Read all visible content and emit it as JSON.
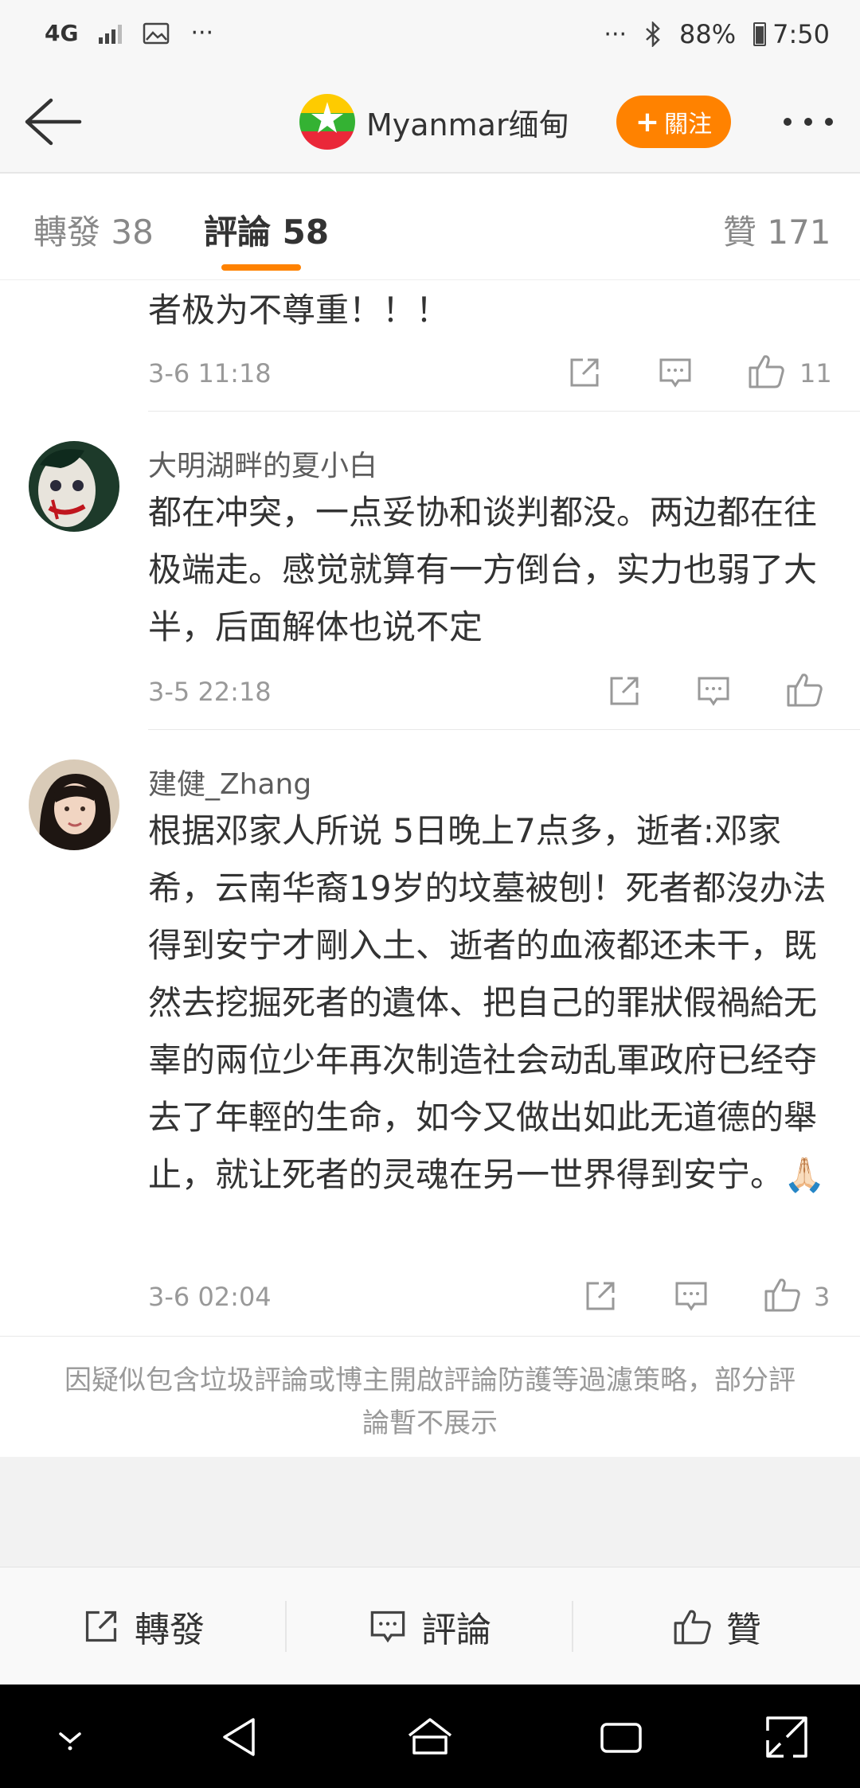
{
  "status_bar": {
    "network": "4G",
    "battery": "88%",
    "time": "7:50"
  },
  "header": {
    "account_name": "Myanmar缅甸",
    "follow_label": "關注",
    "follow_plus": "+"
  },
  "tabs": {
    "reposts": "轉發 38",
    "comments": "評論 58",
    "likes": "贊 171"
  },
  "comments": [
    {
      "text": "者极为不尊重！！！",
      "time": "3-6 11:18",
      "likes": "11"
    },
    {
      "author": "大明湖畔的夏小白",
      "text": "都在冲突，一点妥协和谈判都没。两边都在往极端走。感觉就算有一方倒台，实力也弱了大半，后面解体也说不定",
      "time": "3-5 22:18",
      "likes": ""
    },
    {
      "author": "建健_Zhang",
      "text": "根据邓家人所说 5日晚上7点多，逝者:邓家希，云南华裔19岁的坟墓被刨！死者都沒办法得到安宁才剛入土、逝者的血液都还未干，既然去挖掘死者的遺体、把自己的罪狀假禍給无辜的兩位少年再次制造社会动乱軍政府已经夺去了年輕的生命，如今又做出如此无道德的舉止，就让死者的灵魂在另一世界得到安宁。🙏🏻",
      "time": "3-6 02:04",
      "likes": "3"
    }
  ],
  "filter_notice": "因疑似包含垃圾評論或博主開啟評論防護等過濾策略，部分評論暫不展示",
  "bottom_bar": {
    "repost": "轉發",
    "comment": "評論",
    "like": "贊"
  },
  "colors": {
    "accent": "#ff8200",
    "text_primary": "#333333",
    "text_secondary": "#999999"
  }
}
